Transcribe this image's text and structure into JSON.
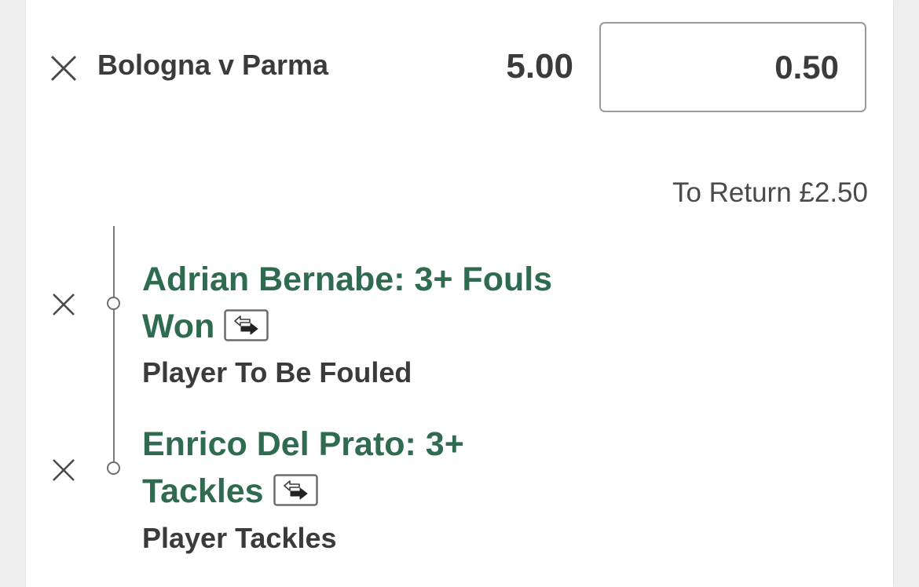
{
  "bet": {
    "event": "Bologna v Parma",
    "odds": "5.00",
    "stake": "0.50",
    "to_return": "To Return £2.50"
  },
  "legs": [
    {
      "selection_line1": "Adrian Bernabe: 3+ Fouls",
      "selection_line2": "Won",
      "market": "Player To Be Fouled"
    },
    {
      "selection_line1": "Enrico Del Prato: 3+",
      "selection_line2": "Tackles",
      "market": "Player Tackles"
    }
  ],
  "colors": {
    "selection_green": "#2f6b4f",
    "text_dark": "#3b3b3b",
    "background": "#efefef"
  },
  "icons": [
    "close-icon",
    "swap-icon",
    "timeline-dot"
  ]
}
